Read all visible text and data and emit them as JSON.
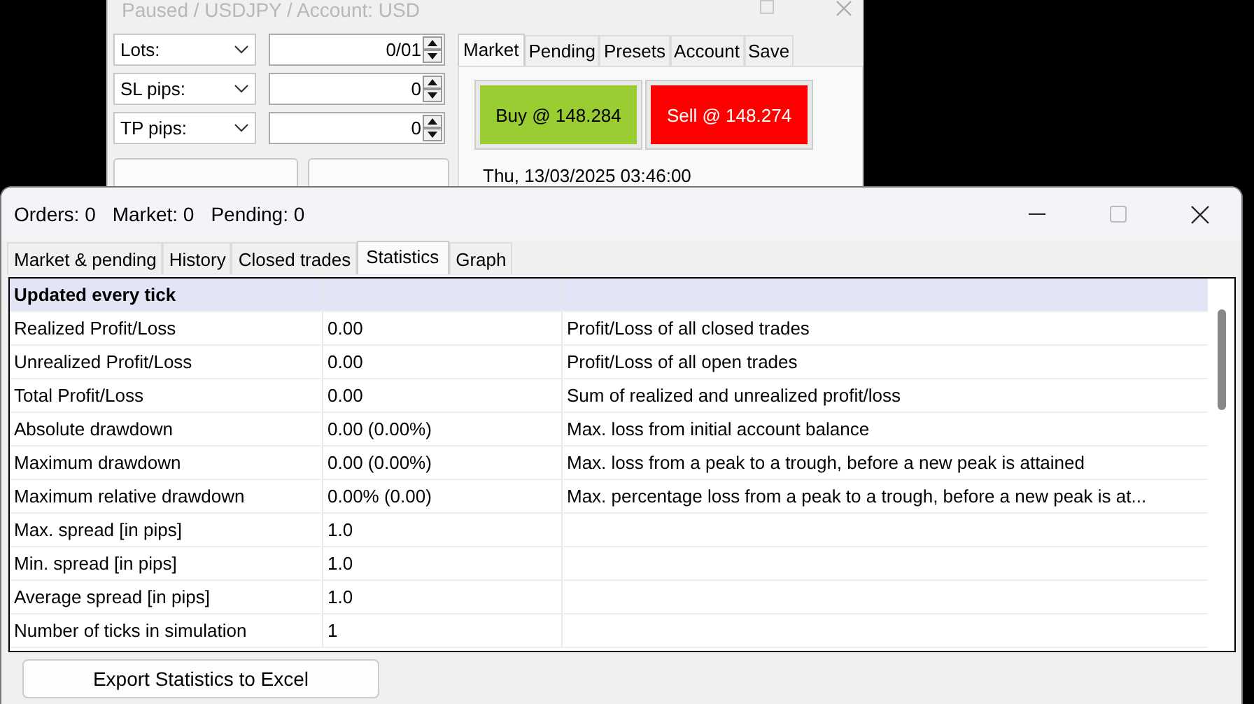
{
  "back_window": {
    "title": "Paused / USDJPY / Account: USD",
    "fields": [
      {
        "label": "Lots:",
        "value": "0/01"
      },
      {
        "label": "SL pips:",
        "value": "0"
      },
      {
        "label": "TP pips:",
        "value": "0"
      }
    ],
    "tabs": [
      {
        "label": "Market",
        "selected": true
      },
      {
        "label": "Pending",
        "selected": false
      },
      {
        "label": "Presets",
        "selected": false
      },
      {
        "label": "Account",
        "selected": false
      },
      {
        "label": "Save",
        "selected": false
      }
    ],
    "buy_button": "Buy @ 148.284",
    "sell_button": "Sell @ 148.274",
    "datetime": "Thu, 13/03/2025  03:46:00"
  },
  "window": {
    "status": [
      {
        "text": "Orders: 0"
      },
      {
        "text": "Market: 0"
      },
      {
        "text": "Pending: 0"
      }
    ],
    "tabs": [
      {
        "label": "Market & pending",
        "selected": false
      },
      {
        "label": "History",
        "selected": false
      },
      {
        "label": "Closed trades",
        "selected": false
      },
      {
        "label": "Statistics",
        "selected": true
      },
      {
        "label": "Graph",
        "selected": false
      }
    ],
    "table": {
      "rows": [
        {
          "kind": "section",
          "cells": [
            "Updated every tick"
          ]
        },
        {
          "kind": "data",
          "cells": [
            "Realized Profit/Loss",
            "0.00",
            "Profit/Loss of all closed trades"
          ]
        },
        {
          "kind": "data",
          "cells": [
            "Unrealized Profit/Loss",
            "0.00",
            "Profit/Loss of all open trades"
          ]
        },
        {
          "kind": "data",
          "cells": [
            "Total Profit/Loss",
            "0.00",
            "Sum of realized and unrealized profit/loss"
          ]
        },
        {
          "kind": "data",
          "cells": [
            "Absolute drawdown",
            "0.00 (0.00%)",
            "Max. loss from initial account balance"
          ]
        },
        {
          "kind": "data",
          "cells": [
            "Maximum drawdown",
            "0.00 (0.00%)",
            "Max. loss from a peak to a trough, before a new peak is attained"
          ]
        },
        {
          "kind": "data",
          "cells": [
            "Maximum relative drawdown",
            "0.00% (0.00)",
            "Max. percentage loss from a peak to a trough, before a new peak is at..."
          ]
        },
        {
          "kind": "data",
          "cells": [
            "Max. spread [in pips]",
            "1.0"
          ]
        },
        {
          "kind": "data",
          "cells": [
            "Min. spread [in pips]",
            "1.0"
          ]
        },
        {
          "kind": "data",
          "cells": [
            "Average spread [in pips]",
            "1.0"
          ]
        },
        {
          "kind": "data",
          "cells": [
            "Number of ticks in simulation",
            "1"
          ]
        }
      ]
    },
    "export_button": "Export Statistics to Excel"
  }
}
